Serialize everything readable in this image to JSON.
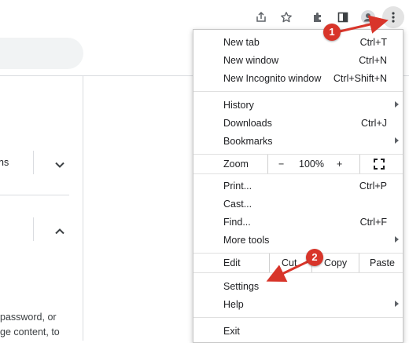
{
  "toolbar": {
    "icons": [
      "share-icon",
      "bookmark-star-icon",
      "extensions-icon",
      "side-panel-icon",
      "profile-icon",
      "more-menu-icon"
    ]
  },
  "page": {
    "row1_text": "ns",
    "paragraph_line1": "password, or",
    "paragraph_line2": "ge content, to"
  },
  "menu": {
    "group1": [
      {
        "label": "New tab",
        "shortcut": "Ctrl+T"
      },
      {
        "label": "New window",
        "shortcut": "Ctrl+N"
      },
      {
        "label": "New Incognito window",
        "shortcut": "Ctrl+Shift+N"
      }
    ],
    "group2": [
      {
        "label": "History",
        "shortcut": ""
      },
      {
        "label": "Downloads",
        "shortcut": "Ctrl+J"
      },
      {
        "label": "Bookmarks",
        "shortcut": ""
      }
    ],
    "zoom": {
      "label": "Zoom",
      "minus": "−",
      "value": "100%",
      "plus": "+"
    },
    "group3": [
      {
        "label": "Print...",
        "shortcut": "Ctrl+P"
      },
      {
        "label": "Cast...",
        "shortcut": ""
      },
      {
        "label": "Find...",
        "shortcut": "Ctrl+F"
      },
      {
        "label": "More tools",
        "shortcut": ""
      }
    ],
    "edit": {
      "label": "Edit",
      "cut": "Cut",
      "copy": "Copy",
      "paste": "Paste"
    },
    "group4": [
      {
        "label": "Settings",
        "shortcut": ""
      },
      {
        "label": "Help",
        "shortcut": ""
      }
    ],
    "exit": {
      "label": "Exit"
    }
  },
  "callouts": {
    "badge1": "1",
    "badge2": "2"
  },
  "colors": {
    "callout": "#d8352a",
    "menu_button_bg": "#e3e3e3"
  }
}
